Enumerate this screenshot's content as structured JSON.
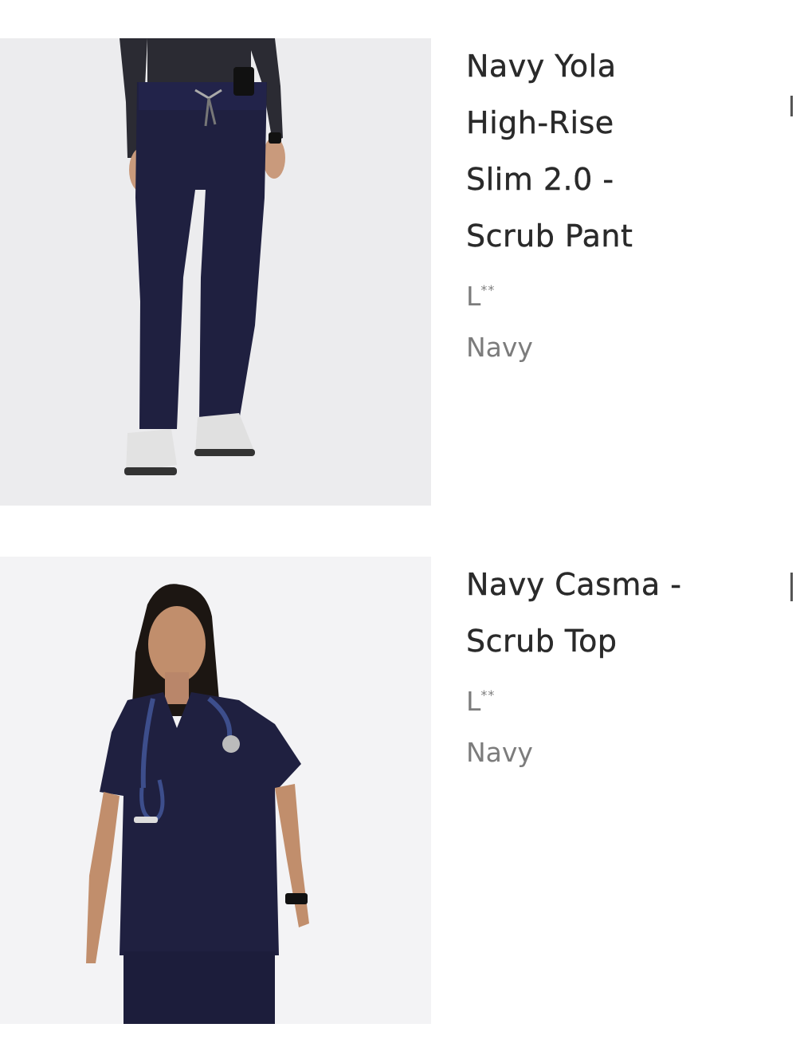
{
  "cart": {
    "items": [
      {
        "title": "Navy Yola High-Rise Slim 2.0 - Scrub Pant",
        "size": "L",
        "size_mark": "**",
        "color": "Navy",
        "image": "navy-scrub-pants-photo"
      },
      {
        "title": "Navy Casma - Scrub Top",
        "size": "L",
        "size_mark": "**",
        "color": "Navy",
        "image": "navy-scrub-top-photo"
      }
    ]
  },
  "colors": {
    "navy": "#1f2040",
    "title_text": "#2a2a2a",
    "meta_text": "#7c7c7c",
    "photo_bg": "#ececee"
  }
}
